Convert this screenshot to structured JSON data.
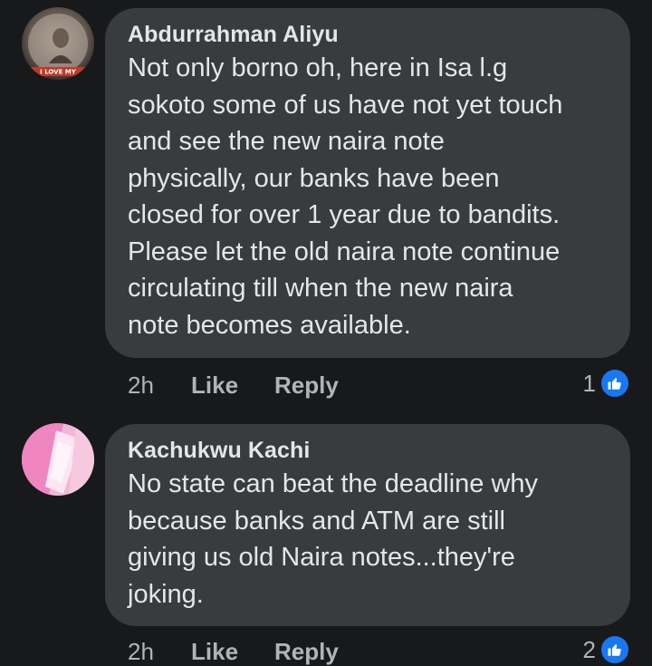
{
  "comments": [
    {
      "author": "Abdurrahman Aliyu",
      "lines": [
        "Not only borno oh, here in Isa l.g",
        "sokoto some of us have not yet touch",
        "and see the new naira note",
        "physically, our banks have been",
        "closed for over 1 year due to bandits.",
        "Please let the old naira note continue",
        "circulating till when the new naira",
        "note becomes available."
      ],
      "time": "2h",
      "like_label": "Like",
      "reply_label": "Reply",
      "reaction_count": "1",
      "avatar_text": "I LOVE MY"
    },
    {
      "author": "Kachukwu Kachi",
      "lines": [
        "No state can beat the deadline why",
        "because banks and ATM are still",
        "giving us old Naira notes...they're",
        "joking."
      ],
      "time": "2h",
      "like_label": "Like",
      "reply_label": "Reply",
      "reaction_count": "2"
    }
  ],
  "colors": {
    "background": "#18191a",
    "bubble": "#3a3b3c",
    "text": "#e4e6eb",
    "secondary_text": "#b0b3b8",
    "like_blue": "#1877f2"
  }
}
